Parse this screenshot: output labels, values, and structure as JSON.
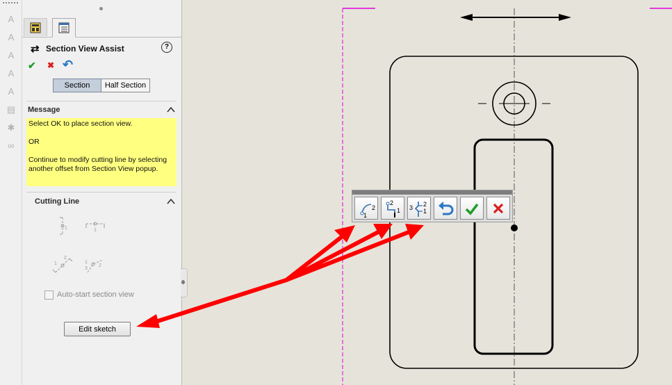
{
  "left_strip": {
    "icons": [
      "note-icon",
      "note-edit-icon",
      "note-alt-icon",
      "note-stack-icon",
      "note-layer-icon",
      "printer-icon",
      "surface-finish-icon",
      "link-icon"
    ]
  },
  "panel": {
    "tabs": [
      {
        "icon": "property-manager-icon",
        "active": false
      },
      {
        "icon": "configuration-list-icon",
        "active": true
      }
    ],
    "title": "Section View Assist",
    "help_glyph": "?",
    "ok_glyph": "✔",
    "cancel_glyph": "✖",
    "undo_glyph": "↶",
    "toggle": {
      "section": "Section",
      "half_section": "Half Section",
      "selected": "Section"
    },
    "message": {
      "heading": "Message",
      "line1": "Select OK to place section view.",
      "line2": "OR",
      "line3": "Continue to modify cutting line by selecting another offset from Section View popup."
    },
    "cutting_line": {
      "heading": "Cutting Line",
      "icons": [
        "vertical-cutting-line-icon",
        "horizontal-cutting-line-icon",
        "auxiliary-cutting-line-icon",
        "aligned-cutting-line-icon"
      ]
    },
    "auto_start_label": "Auto-start section view",
    "auto_start_checked": false,
    "edit_sketch_label": "Edit sketch"
  },
  "popup": {
    "buttons": [
      {
        "name": "arc-offset-button",
        "icon": "arc-offset-icon",
        "badge_top": "",
        "badge_bottom": "2",
        "badge_left": "1"
      },
      {
        "name": "single-offset-button",
        "icon": "single-offset-icon",
        "badge_top": "2",
        "badge_bottom": "1",
        "badge_left": ""
      },
      {
        "name": "notch-offset-button",
        "icon": "notch-offset-icon",
        "badge_top": "2",
        "badge_bottom": "1",
        "badge_left": "3"
      },
      {
        "name": "undo-button",
        "icon": "undo-icon"
      },
      {
        "name": "ok-button",
        "icon": "checkmark-icon"
      },
      {
        "name": "cancel-button",
        "icon": "close-icon"
      }
    ]
  },
  "colors": {
    "canvas": "#e6e4da",
    "panel": "#f0f0f0",
    "message_bg": "#ffff80",
    "annotation_arrow": "#ff0000",
    "ok_green": "#1f9d2b",
    "cancel_red": "#d81e1e",
    "undo_blue": "#2d78c8",
    "sheet_border": "#e000e0"
  }
}
